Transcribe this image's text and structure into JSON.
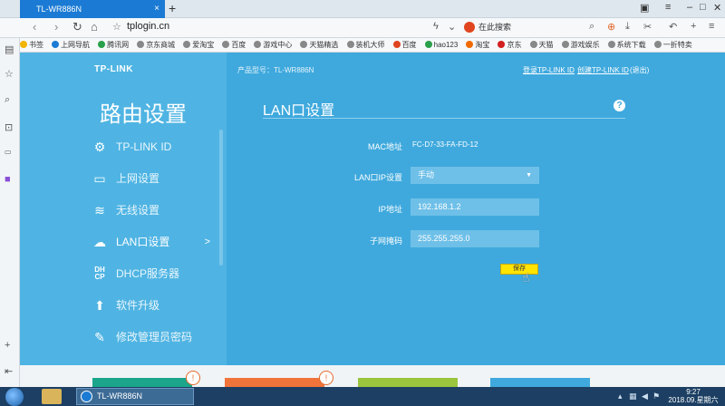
{
  "browser": {
    "tab_title": "TL-WR886N",
    "tab_close": "×",
    "new_tab": "+",
    "url": "tplogin.cn",
    "search_placeholder": "在此搜索",
    "bookmarks": [
      "书签",
      "上网导航",
      "腾讯网",
      "京东商城",
      "爱淘宝",
      "百度",
      "游戏中心",
      "天猫精选",
      "装机大师",
      "百度",
      "hao123",
      "淘宝",
      "京东",
      "天猫",
      "游戏娱乐",
      "系统下载",
      "一折特卖"
    ]
  },
  "router": {
    "logo": "TP-LINK",
    "page_title": "路由设置",
    "model_text": "产品型号：TL-WR886N",
    "link_login": "登录TP-LINK ID",
    "link_create": "创建TP-LINK ID",
    "link_exit": "(退出)",
    "menu": [
      {
        "label": "TP-LINK ID",
        "icon": "gear-icon"
      },
      {
        "label": "上网设置",
        "icon": "monitor-icon"
      },
      {
        "label": "无线设置",
        "icon": "wifi-icon"
      },
      {
        "label": "LAN口设置",
        "icon": "cloud-icon",
        "active": true
      },
      {
        "label": "DHCP服务器",
        "icon": "dhcp-icon"
      },
      {
        "label": "软件升级",
        "icon": "upload-icon"
      },
      {
        "label": "修改管理员密码",
        "icon": "pencil-icon"
      }
    ],
    "active_arrow": ">",
    "section_title": "LAN口设置",
    "help": "?",
    "form": {
      "mac_label": "MAC地址",
      "mac_value": "FC-D7-33-FA-FD-12",
      "lan_ip_label": "LAN口IP设置",
      "lan_ip_value": "手动",
      "ip_label": "IP地址",
      "ip_value": "192.168.1.2",
      "mask_label": "子网掩码",
      "mask_value": "255.255.255.0",
      "save_label": "保存"
    },
    "badges": [
      "!",
      "!"
    ]
  },
  "taskbar": {
    "task_title": "TL-WR886N",
    "time": "9:27",
    "date": "2018.09.星期六"
  },
  "colors": {
    "page_bg": "#3fa9dd",
    "panel_bg": "#4fb4e3",
    "save_button": "#ffe400",
    "tab_active": "#1b7bd4"
  }
}
